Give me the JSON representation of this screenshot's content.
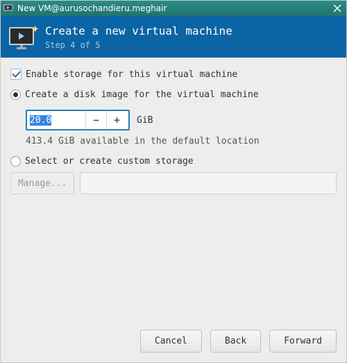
{
  "titlebar": {
    "title": "New VM@aurusochandieru.meghair"
  },
  "header": {
    "title": "Create a new virtual machine",
    "step": "Step 4 of 5"
  },
  "storage": {
    "enable_label": "Enable storage for this virtual machine",
    "create_disk_label": "Create a disk image for the virtual machine",
    "size_value": "20.0",
    "unit": "GiB",
    "available_text": "413.4 GiB available in the default location",
    "custom_label": "Select or create custom storage",
    "manage_label": "Manage..."
  },
  "footer": {
    "cancel": "Cancel",
    "back": "Back",
    "forward": "Forward"
  }
}
